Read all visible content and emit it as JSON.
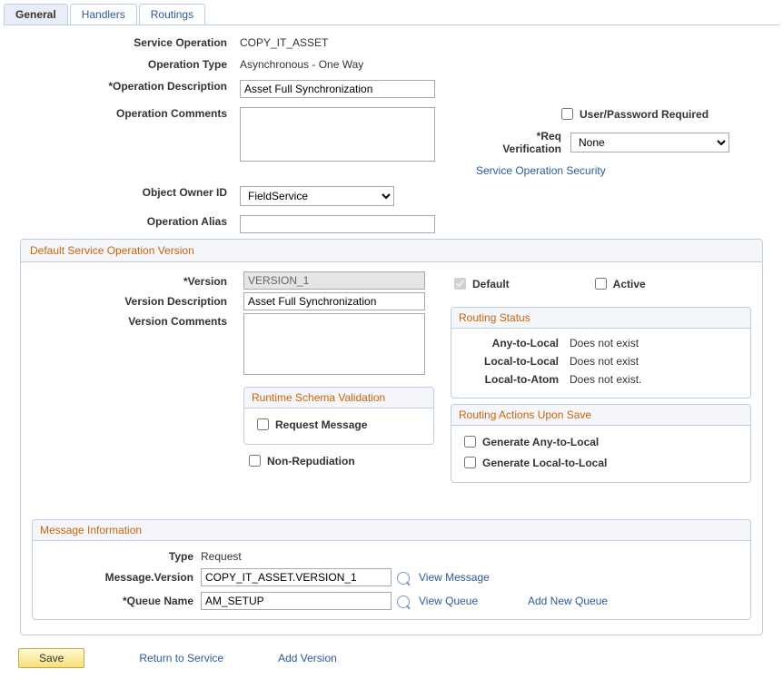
{
  "tabs": {
    "general": "General",
    "handlers": "Handlers",
    "routings": "Routings"
  },
  "fields": {
    "serviceOperationLabel": "Service Operation",
    "serviceOperationValue": "COPY_IT_ASSET",
    "operationTypeLabel": "Operation Type",
    "operationTypeValue": "Asynchronous - One Way",
    "operationDescLabel": "*Operation Description",
    "operationDescValue": "Asset Full Synchronization",
    "operationCommentsLabel": "Operation Comments",
    "operationCommentsValue": "",
    "objectOwnerLabel": "Object Owner ID",
    "objectOwnerValue": "FieldService",
    "operationAliasLabel": "Operation Alias",
    "operationAliasValue": "",
    "userPwdLabel": "User/Password Required",
    "reqVerificationLabel": "*Req Verification",
    "reqVerificationValue": "None",
    "securityLink": "Service Operation Security"
  },
  "defaultVersion": {
    "boxTitle": "Default Service Operation Version",
    "versionLabel": "*Version",
    "versionValue": "VERSION_1",
    "versionDescLabel": "Version Description",
    "versionDescValue": "Asset Full Synchronization",
    "versionCommentsLabel": "Version Comments",
    "versionCommentsValue": "",
    "defaultLabel": "Default",
    "activeLabel": "Active",
    "routingStatusTitle": "Routing Status",
    "routing": {
      "anyLocalLabel": "Any-to-Local",
      "anyLocalVal": "Does not exist",
      "localLocalLabel": "Local-to-Local",
      "localLocalVal": "Does not exist",
      "localAtomLabel": "Local-to-Atom",
      "localAtomVal": "Does not exist."
    },
    "runtimeTitle": "Runtime Schema Validation",
    "requestMessageLabel": "Request Message",
    "routingActionsTitle": "Routing Actions Upon Save",
    "genAnyLocalLabel": "Generate Any-to-Local",
    "genLocalLocalLabel": "Generate Local-to-Local",
    "nonRepudiationLabel": "Non-Repudiation"
  },
  "messageInfo": {
    "boxTitle": "Message Information",
    "typeLabel": "Type",
    "typeValue": "Request",
    "msgVersionLabel": "Message.Version",
    "msgVersionValue": "COPY_IT_ASSET.VERSION_1",
    "viewMessageLink": "View Message",
    "queueNameLabel": "*Queue Name",
    "queueNameValue": "AM_SETUP",
    "viewQueueLink": "View Queue",
    "addNewQueueLink": "Add New Queue"
  },
  "buttons": {
    "save": "Save",
    "returnToService": "Return to Service",
    "addVersion": "Add Version"
  }
}
